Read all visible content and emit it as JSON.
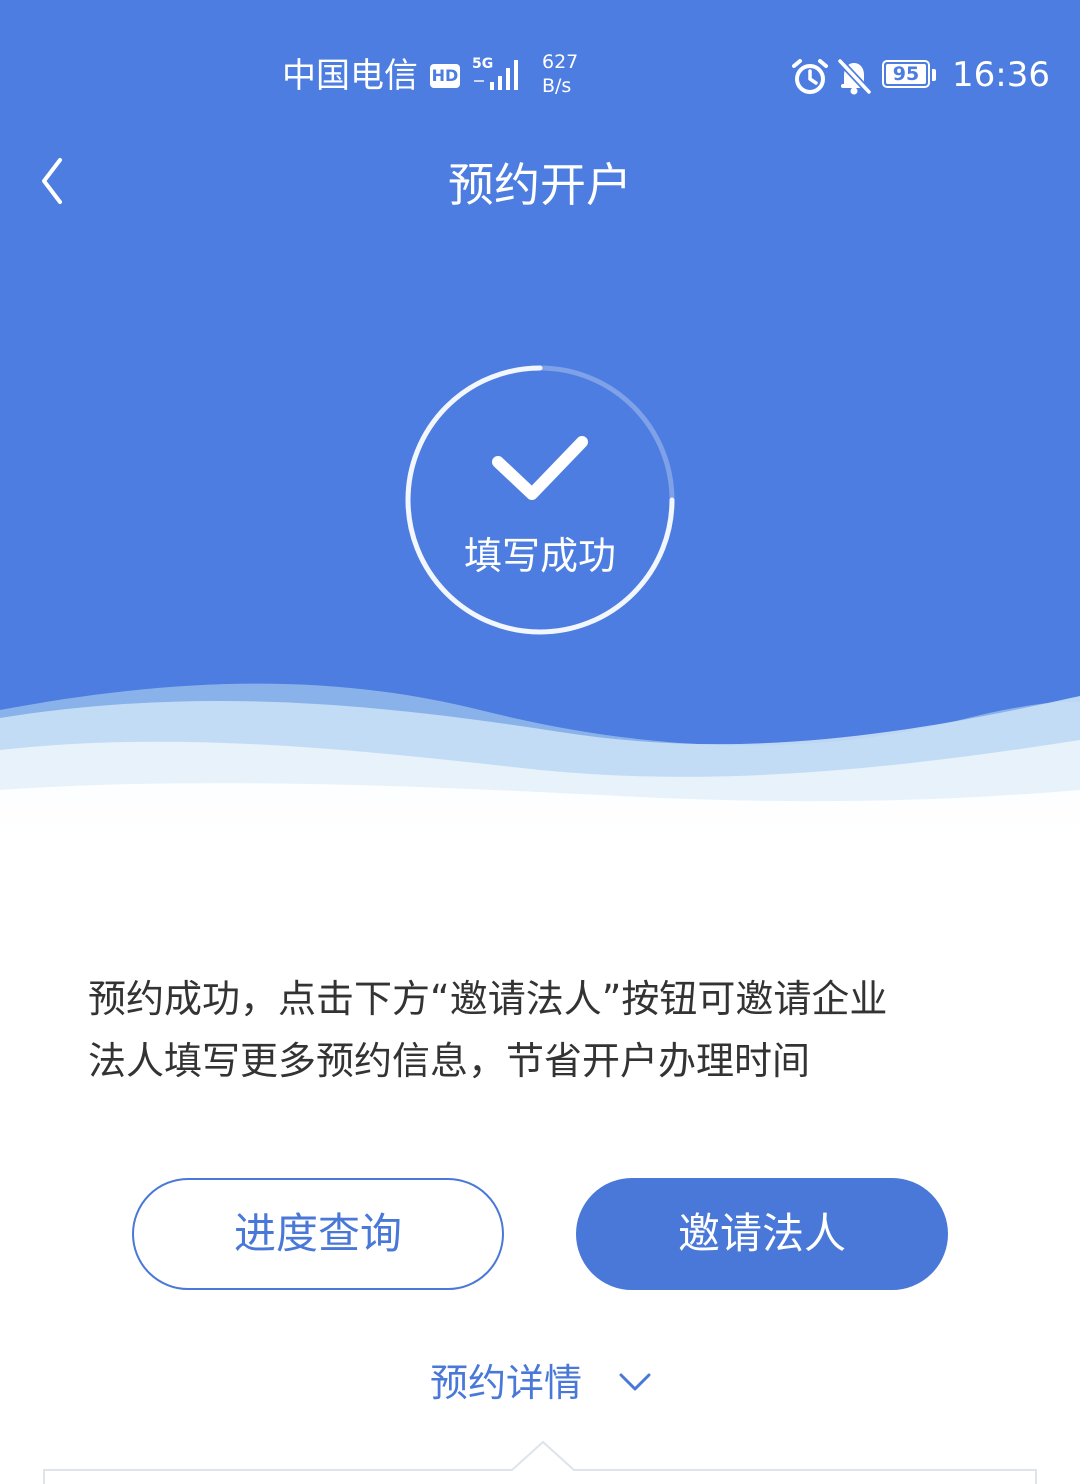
{
  "status_bar": {
    "carrier": "中国电信",
    "hd_badge": "HD",
    "network_type": "5G",
    "net_speed_value": "627",
    "net_speed_unit": "B/s",
    "battery_level": "95",
    "time": "16:36"
  },
  "nav": {
    "title": "预约开户"
  },
  "result": {
    "label": "填写成功"
  },
  "message": {
    "line1": "预约成功，点击下方“邀请法人”按钮可邀请企业",
    "line2": "法人填写更多预约信息，节省开户办理时间"
  },
  "actions": {
    "progress_query_label": "进度查询",
    "invite_legal_person_label": "邀请法人"
  },
  "details": {
    "toggle_label": "预约详情"
  },
  "colors": {
    "primary": "#4d7de0",
    "button_blue": "#4a78d8",
    "text": "#333333"
  },
  "icons": {
    "back": "chevron-left-icon",
    "check": "check-icon",
    "alarm": "alarm-icon",
    "mute": "bell-off-icon",
    "signal": "signal-icon",
    "expand": "chevron-down-icon"
  }
}
